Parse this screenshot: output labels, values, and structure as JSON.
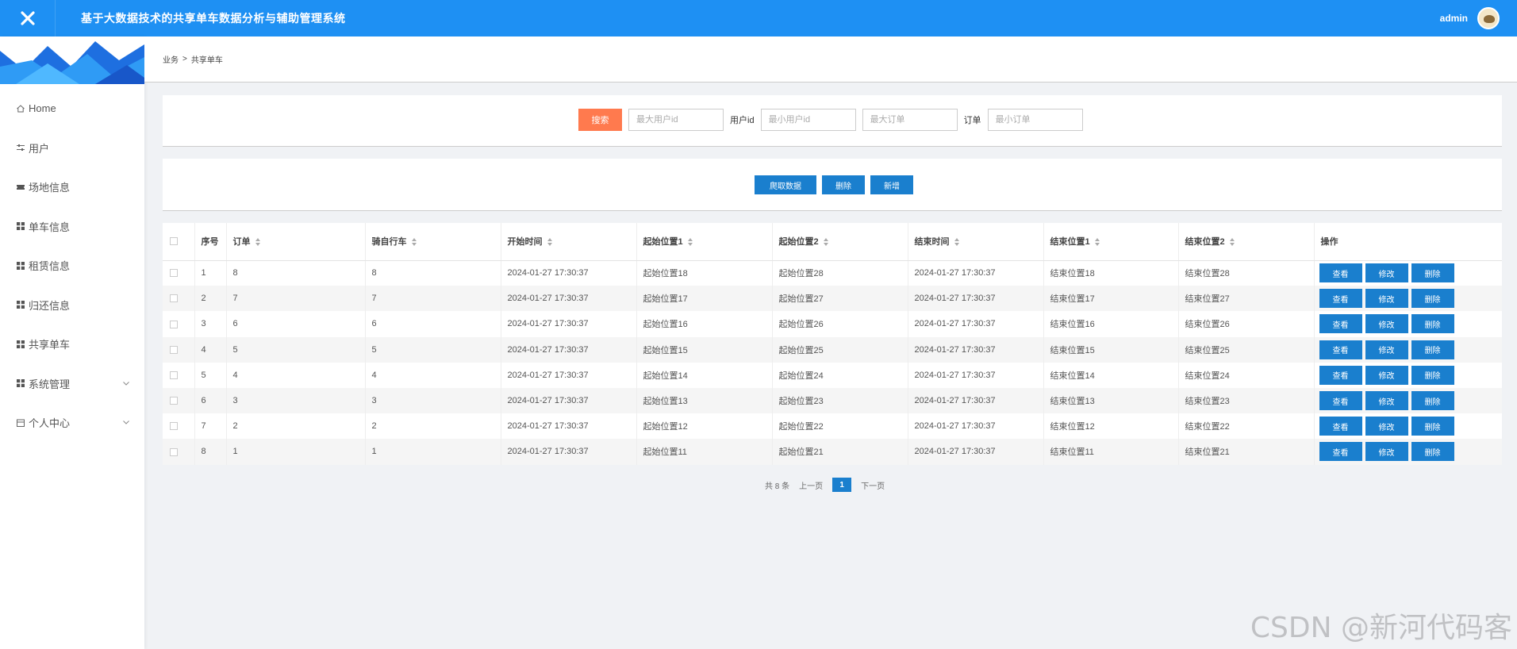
{
  "app": {
    "title": "基于大数据技术的共享单车数据分析与辅助管理系统",
    "username": "admin"
  },
  "colors": {
    "topbar": "#1e90f3",
    "primary_button": "#1a7fce",
    "search_button": "#ff7a4e"
  },
  "sidebar": {
    "items": [
      {
        "label": "Home",
        "icon": "home-icon"
      },
      {
        "label": "用户",
        "icon": "sliders-icon"
      },
      {
        "label": "场地信息",
        "icon": "ticket-icon"
      },
      {
        "label": "单车信息",
        "icon": "grid-icon"
      },
      {
        "label": "租赁信息",
        "icon": "grid-icon"
      },
      {
        "label": "归还信息",
        "icon": "grid-icon"
      },
      {
        "label": "共享单车",
        "icon": "grid-icon"
      },
      {
        "label": "系统管理",
        "icon": "grid-icon",
        "expandable": true
      },
      {
        "label": "个人中心",
        "icon": "calendar-icon",
        "expandable": true
      }
    ]
  },
  "breadcrumb": {
    "parent": "业务",
    "separator": ">",
    "current": "共享单车"
  },
  "search": {
    "button_label": "搜索",
    "max_user_placeholder": "最大用户id",
    "user_label": "用户id",
    "min_user_placeholder": "最小用户id",
    "max_order_placeholder": "最大订单",
    "order_label": "订单",
    "min_order_placeholder": "最小订单"
  },
  "actions": {
    "crawl": "爬取数据",
    "delete": "删除",
    "add": "新增"
  },
  "table": {
    "headers": {
      "index": "序号",
      "order": "订单",
      "bike": "骑自行车",
      "start_time": "开始时间",
      "start_loc1": "起始位置1",
      "start_loc2": "起始位置2",
      "end_time": "结束时间",
      "end_loc1": "结束位置1",
      "end_loc2": "结束位置2",
      "ops": "操作"
    },
    "op_labels": {
      "view": "查看",
      "edit": "修改",
      "delete": "删除"
    },
    "rows": [
      {
        "index": "1",
        "order": "8",
        "bike": "8",
        "start_time": "2024-01-27 17:30:37",
        "start_loc1": "起始位置18",
        "start_loc2": "起始位置28",
        "end_time": "2024-01-27 17:30:37",
        "end_loc1": "结束位置18",
        "end_loc2": "结束位置28"
      },
      {
        "index": "2",
        "order": "7",
        "bike": "7",
        "start_time": "2024-01-27 17:30:37",
        "start_loc1": "起始位置17",
        "start_loc2": "起始位置27",
        "end_time": "2024-01-27 17:30:37",
        "end_loc1": "结束位置17",
        "end_loc2": "结束位置27"
      },
      {
        "index": "3",
        "order": "6",
        "bike": "6",
        "start_time": "2024-01-27 17:30:37",
        "start_loc1": "起始位置16",
        "start_loc2": "起始位置26",
        "end_time": "2024-01-27 17:30:37",
        "end_loc1": "结束位置16",
        "end_loc2": "结束位置26"
      },
      {
        "index": "4",
        "order": "5",
        "bike": "5",
        "start_time": "2024-01-27 17:30:37",
        "start_loc1": "起始位置15",
        "start_loc2": "起始位置25",
        "end_time": "2024-01-27 17:30:37",
        "end_loc1": "结束位置15",
        "end_loc2": "结束位置25"
      },
      {
        "index": "5",
        "order": "4",
        "bike": "4",
        "start_time": "2024-01-27 17:30:37",
        "start_loc1": "起始位置14",
        "start_loc2": "起始位置24",
        "end_time": "2024-01-27 17:30:37",
        "end_loc1": "结束位置14",
        "end_loc2": "结束位置24"
      },
      {
        "index": "6",
        "order": "3",
        "bike": "3",
        "start_time": "2024-01-27 17:30:37",
        "start_loc1": "起始位置13",
        "start_loc2": "起始位置23",
        "end_time": "2024-01-27 17:30:37",
        "end_loc1": "结束位置13",
        "end_loc2": "结束位置23"
      },
      {
        "index": "7",
        "order": "2",
        "bike": "2",
        "start_time": "2024-01-27 17:30:37",
        "start_loc1": "起始位置12",
        "start_loc2": "起始位置22",
        "end_time": "2024-01-27 17:30:37",
        "end_loc1": "结束位置12",
        "end_loc2": "结束位置22"
      },
      {
        "index": "8",
        "order": "1",
        "bike": "1",
        "start_time": "2024-01-27 17:30:37",
        "start_loc1": "起始位置11",
        "start_loc2": "起始位置21",
        "end_time": "2024-01-27 17:30:37",
        "end_loc1": "结束位置11",
        "end_loc2": "结束位置21"
      }
    ]
  },
  "pagination": {
    "total": "共 8 条",
    "prev": "上一页",
    "current": "1",
    "next": "下一页"
  },
  "watermark": "CSDN @新河代码客"
}
